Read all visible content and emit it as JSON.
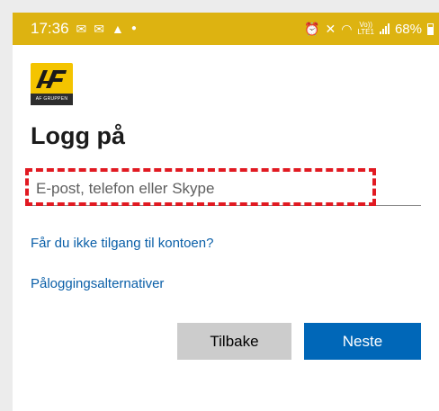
{
  "status_bar": {
    "time": "17:36",
    "left_icons": [
      "mail-icon",
      "mail-icon",
      "navigation-icon",
      "dot-icon"
    ],
    "volte_label": "Vo))",
    "lte_label": "LTE1",
    "battery_percent": "68%",
    "background": "#ddb311"
  },
  "logo": {
    "name": "AF GRUPPEN"
  },
  "page": {
    "title": "Logg på"
  },
  "form": {
    "email_placeholder": "E-post, telefon eller Skype",
    "email_value": ""
  },
  "links": {
    "no_access": "Får du ikke tilgang til kontoen?",
    "signin_options": "Påloggingsalternativer"
  },
  "buttons": {
    "back": "Tilbake",
    "next": "Neste"
  },
  "colors": {
    "accent": "#0067b8",
    "highlight": "#e11a22",
    "link": "#0a5fa8"
  }
}
